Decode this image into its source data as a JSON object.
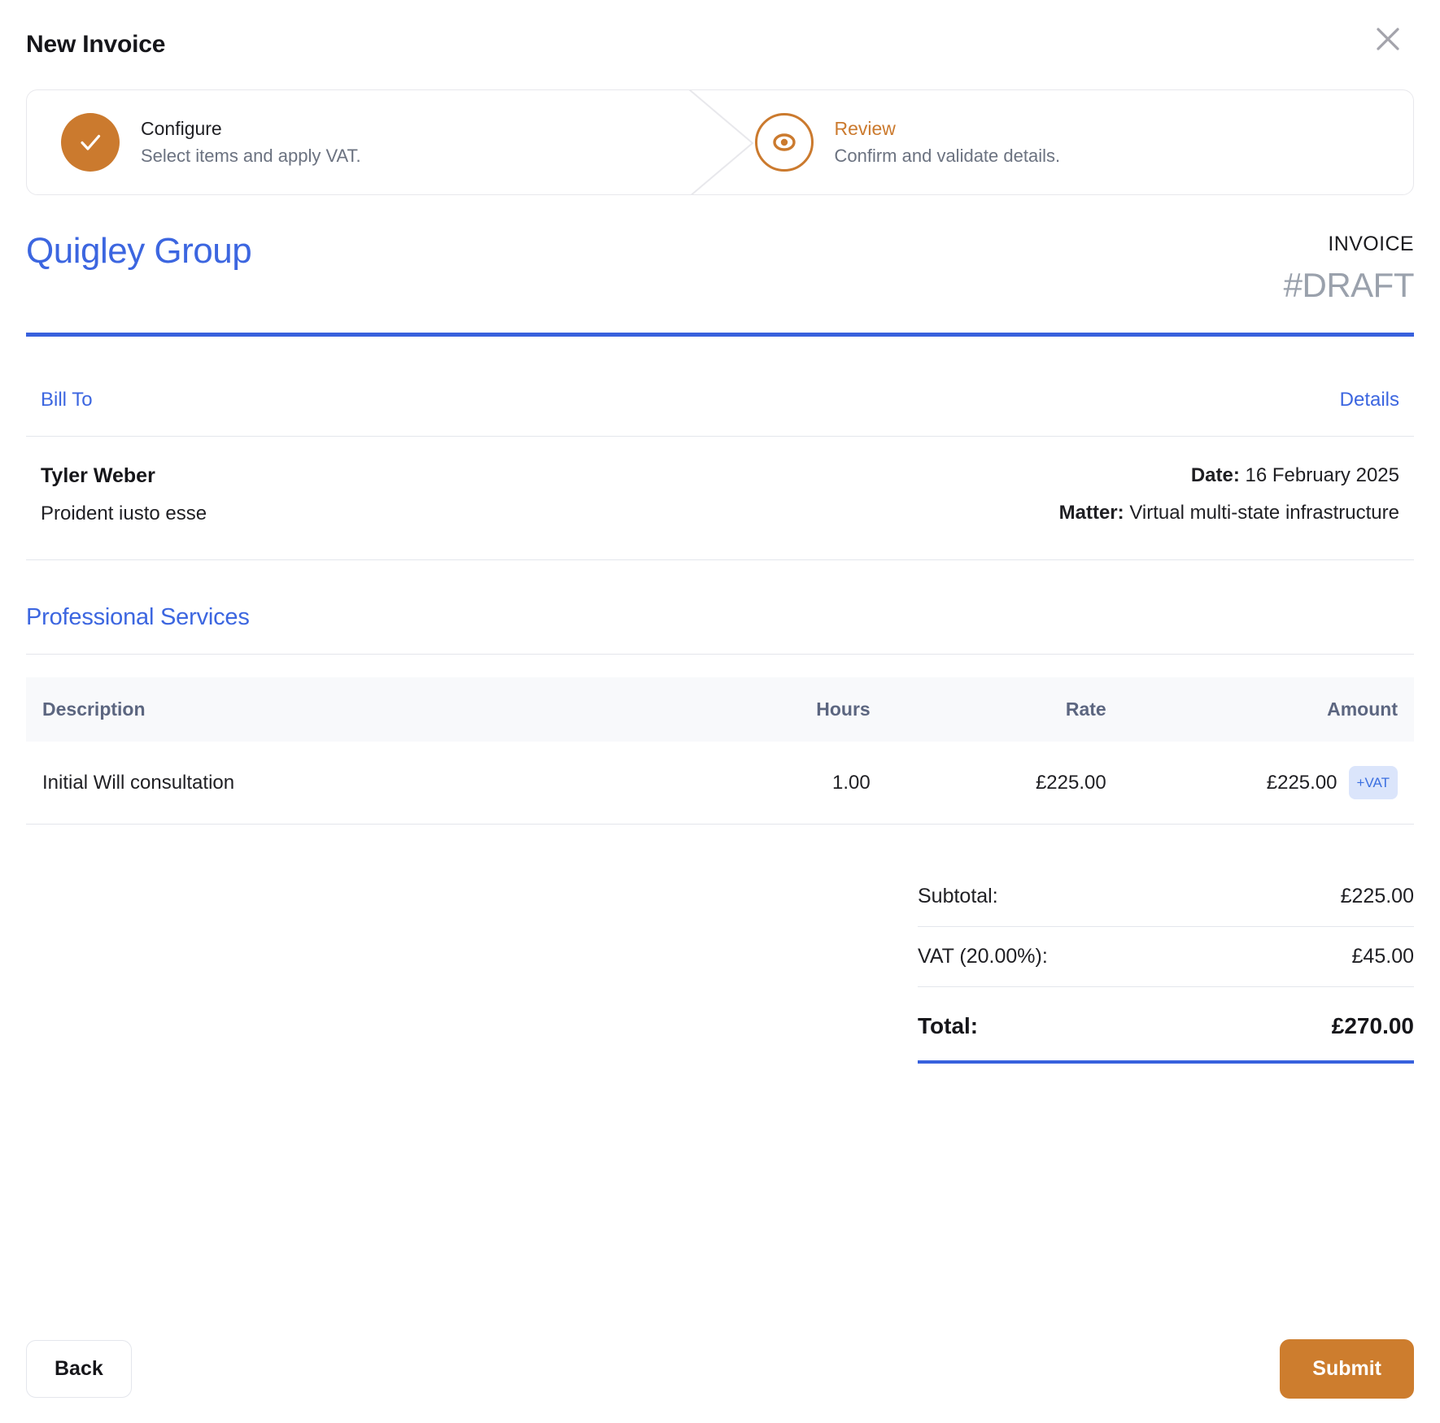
{
  "modal": {
    "title": "New Invoice",
    "close_icon": "close-icon"
  },
  "stepper": {
    "steps": [
      {
        "label": "Configure",
        "desc": "Select items and apply VAT.",
        "state": "done",
        "icon": "check-icon"
      },
      {
        "label": "Review",
        "desc": "Confirm and validate details.",
        "state": "current",
        "icon": "eye-icon"
      }
    ]
  },
  "invoice": {
    "company": "Quigley Group",
    "word": "INVOICE",
    "number": "#DRAFT",
    "bill_to_label": "Bill To",
    "details_label": "Details",
    "client_name": "Tyler Weber",
    "client_sub": "Proident iusto esse",
    "date_label": "Date:",
    "date_value": "16 February 2025",
    "matter_label": "Matter:",
    "matter_value": "Virtual multi-state infrastructure"
  },
  "services": {
    "section_title": "Professional Services",
    "columns": [
      "Description",
      "Hours",
      "Rate",
      "Amount"
    ],
    "rows": [
      {
        "description": "Initial Will consultation",
        "hours": "1.00",
        "rate": "£225.00",
        "amount": "£225.00",
        "badge": "+VAT"
      }
    ]
  },
  "totals": {
    "subtotal_label": "Subtotal:",
    "subtotal_value": "£225.00",
    "vat_label": "VAT (20.00%):",
    "vat_value": "£45.00",
    "total_label": "Total:",
    "total_value": "£270.00"
  },
  "footer": {
    "back_label": "Back",
    "submit_label": "Submit"
  },
  "colors": {
    "accent_orange": "#cb7a2e",
    "link_blue": "#3c66e0",
    "rule_blue": "#3861dd",
    "badge_bg": "#dbe5fb",
    "badge_text": "#3b6fe0",
    "muted": "#6b7280",
    "header_bg": "#f8f9fb"
  }
}
